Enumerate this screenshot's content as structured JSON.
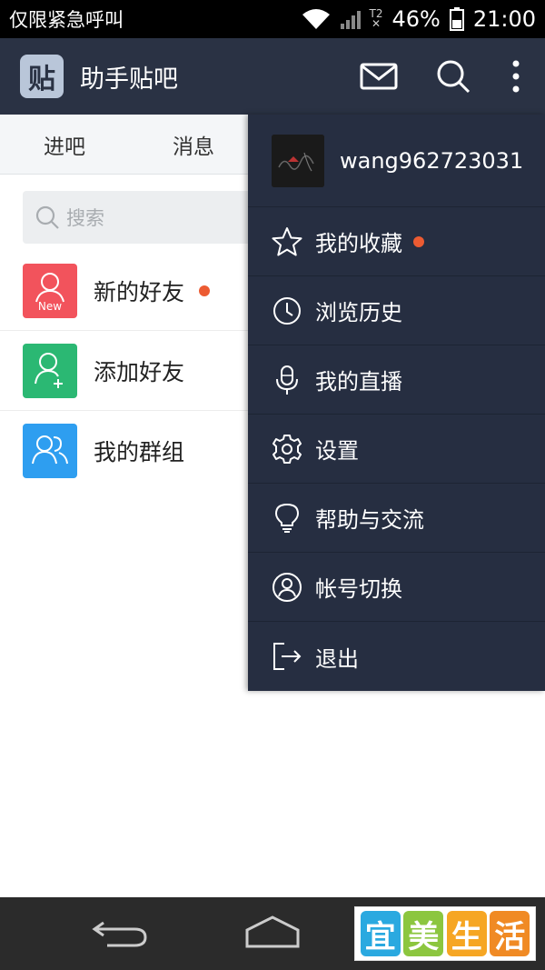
{
  "status_bar": {
    "carrier": "仅限紧急呼叫",
    "battery": "46%",
    "time": "21:00",
    "sim_label": "T2"
  },
  "header": {
    "logo_char": "贴",
    "title": "助手贴吧",
    "background": "#2a3244"
  },
  "tabs": [
    "进吧",
    "消息"
  ],
  "search": {
    "placeholder": "搜索"
  },
  "list": [
    {
      "label": "新的好友",
      "color": "#f2535c",
      "icon": "new-friend-icon",
      "badge_text": "New",
      "has_dot": true
    },
    {
      "label": "添加好友",
      "color": "#2bb873",
      "icon": "add-friend-icon",
      "has_dot": false
    },
    {
      "label": "我的群组",
      "color": "#2e9ef0",
      "icon": "group-icon",
      "has_dot": false
    }
  ],
  "drawer": {
    "username": "wang962723031",
    "background": "#262e41",
    "items": [
      {
        "label": "我的收藏",
        "icon": "star-icon",
        "has_dot": true
      },
      {
        "label": "浏览历史",
        "icon": "clock-icon"
      },
      {
        "label": "我的直播",
        "icon": "microphone-icon"
      },
      {
        "label": "设置",
        "icon": "gear-icon"
      },
      {
        "label": "帮助与交流",
        "icon": "lightbulb-icon"
      },
      {
        "label": "帐号切换",
        "icon": "account-switch-icon"
      },
      {
        "label": "退出",
        "icon": "logout-icon"
      }
    ]
  },
  "watermark": {
    "chars": [
      "宜",
      "美",
      "生",
      "活"
    ],
    "colors": [
      "#2aa9e0",
      "#8cc63f",
      "#f6a623",
      "#f08a24"
    ]
  },
  "accent": "#ec5b32"
}
